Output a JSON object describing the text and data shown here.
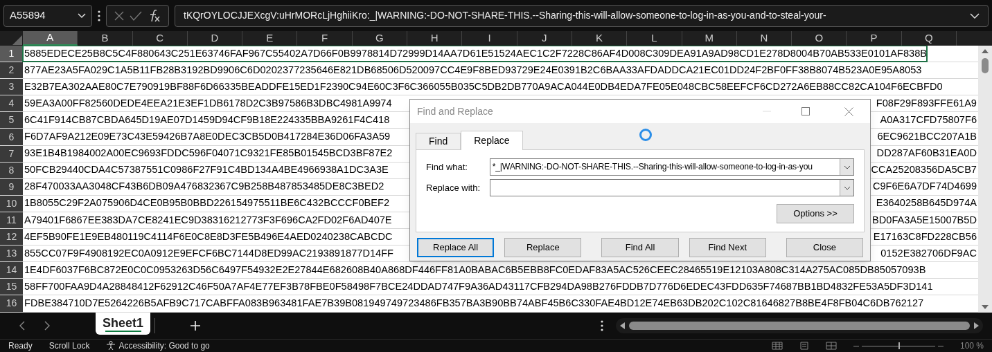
{
  "name_box": {
    "value": "A55894"
  },
  "formula_bar": {
    "value": "tKQrOYLOCJJEXcgV:uHrMORcLjHghiiKro:_|WARNING:-DO-NOT-SHARE-THIS.--Sharing-this-will-allow-someone-to-log-in-as-you-and-to-steal-your-"
  },
  "columns": [
    {
      "label": "A",
      "selected": true
    },
    {
      "label": "B",
      "selected": false
    },
    {
      "label": "C",
      "selected": false
    },
    {
      "label": "D",
      "selected": false
    },
    {
      "label": "E",
      "selected": false
    },
    {
      "label": "F",
      "selected": false
    },
    {
      "label": "G",
      "selected": false
    },
    {
      "label": "H",
      "selected": false
    },
    {
      "label": "I",
      "selected": false
    },
    {
      "label": "J",
      "selected": false
    },
    {
      "label": "K",
      "selected": false
    },
    {
      "label": "L",
      "selected": false
    },
    {
      "label": "M",
      "selected": false
    },
    {
      "label": "N",
      "selected": false
    },
    {
      "label": "O",
      "selected": false
    },
    {
      "label": "P",
      "selected": false
    },
    {
      "label": "Q",
      "selected": false
    }
  ],
  "rows": [
    {
      "number": "1",
      "selected": true,
      "text": "5885EDECE25B8C5C4F880643C251E63746FAF967C55402A7D66F0B9978814D72999D14AA7D61E51524AEC1C2F7228C86AF4D008C309DEA91A9AD98CD1E278D8004B70AB533E0101AF838B"
    },
    {
      "number": "2",
      "selected": false,
      "text": "877AE23A5FA029C1A5B11FB28B3192BD9906C6D0202377235646E821DB68506D520097CC4E9F8BED93729E24E0391B2C6BAA33AFDADDCA21EC01DD24F2BF0FF38B8074B523A0E95A8053"
    },
    {
      "number": "3",
      "selected": false,
      "text": "E32B7EA302AAE80C7E790919BF88F6D66335BEADDFE15ED1F2390C94E60C3F6C366055B035C5DB2DB770A9ACA044E0DB4EDA7FE05E048CBC58EEFCF6CD272A6EB88CC82CA104F6ECBFD0"
    },
    {
      "number": "4",
      "selected": false,
      "text": "59EA3A00FF82560DEDE4EEA21E3EF1DB6178D2C3B97586B3DBC4981A9974",
      "text_right": "F08F29F893FFE61A9"
    },
    {
      "number": "5",
      "selected": false,
      "text": "6C41F914CB87CBDA645D19AE07D1459D94CF9B18E224335BBA9261F4C418",
      "text_right": "A0A317CFD75807F6"
    },
    {
      "number": "6",
      "selected": false,
      "text": "F6D7AF9A212E09E73C43E59426B7A8E0DEC3CB5D0B417284E36D06FA3A59",
      "text_right": "6EC9621BCC207A1B"
    },
    {
      "number": "7",
      "selected": false,
      "text": "93E1B4B1984002A00EC9693FDDC596F04071C9321FE85B01545BCD3BF87E2",
      "text_right": "DD287AF60B31EA0D"
    },
    {
      "number": "8",
      "selected": false,
      "text": "50FCB29440CDA4C57387551C0986F27F91C4BD134A4BE4966938A1DC3A3E",
      "text_right": "CCA25208356DA5CB7"
    },
    {
      "number": "9",
      "selected": false,
      "text": "28F470033AA3048CF43B6DB09A476832367C9B258B487853485DE8C3BED2",
      "text_right": "C9F6E6A7DF74D4699"
    },
    {
      "number": "10",
      "selected": false,
      "text": "1B8055C29F2A075906D4CE0B95B0BBD226154975511BE6C432BCCCF0BEF2",
      "text_right": "E3640258B645D974A"
    },
    {
      "number": "11",
      "selected": false,
      "text": "A79401F6867EE383DA7CE8241EC9D38316212773F3F696CA2FD02F6AD407E",
      "text_right": "BD0FA3A5E15007B5D"
    },
    {
      "number": "12",
      "selected": false,
      "text": "4EF5B90FE1E9EB480119C4114F6E0C8E8D3FE5B496E4AED0240238CABCDC",
      "text_right": "E17163C8FD228CB56"
    },
    {
      "number": "13",
      "selected": false,
      "text": "855CC07F9F4908192EC0A0912E9EFCF6BC7144D8ED99AC2193891877D14FF",
      "text_right": "0152E382706DF9AC"
    },
    {
      "number": "14",
      "selected": false,
      "text": "1E4DF6037F6BC872E0C0C0953263D56C6497F54932E2E27844E682608B40A868DF446FF81A0BABAC6B5EBB8FC0EDAF83A5AC526CEEC28465519E12103A808C314A275AC085DB85057093B"
    },
    {
      "number": "15",
      "selected": false,
      "text": "58FF700FAA9D4A28848412F62912C46F50A7AF4E77EF3B78FBE0F58498F7BCE24DDAD747F9A36AD43117CFB294DA98B276FDDB7D776D6EDEC43FDD635F74687BB1BD4832FE53A5DF3D141"
    },
    {
      "number": "16",
      "selected": false,
      "text": "FDBE384710D7E5264226B5AFB9C717CABFFA083B963481FAE7B39B081949749723486FB357BA3B90BB74ABF45B6C330FAE4BD12E74EB63DB202C102C81646827B8BE4F8FB04C6DB762127"
    }
  ],
  "sheet_tabs": [
    {
      "label": "Sheet1",
      "selected": true
    }
  ],
  "status_bar": {
    "items": [
      "Ready",
      "Scroll Lock",
      "Accessibility: Good to go"
    ],
    "zoom": "100 %",
    "zoom_slider": {
      "level": 0.5
    }
  },
  "dialog": {
    "title": "Find and Replace",
    "tabs": [
      {
        "label": "Find",
        "selected": false
      },
      {
        "label": "Replace",
        "selected": true
      }
    ],
    "fields": [
      {
        "label": "Find what:",
        "value": "*_|WARNING:-DO-NOT-SHARE-THIS.--Sharing-this-will-allow-someone-to-log-in-as-you"
      },
      {
        "label": "Replace with:"
      }
    ],
    "options_button": "Options >>",
    "buttons": [
      {
        "label": "Replace All",
        "default": true
      },
      {
        "label": "Replace",
        "default": false
      },
      {
        "label": "Find All",
        "default": false
      },
      {
        "label": "Find Next",
        "default": false
      },
      {
        "label": "Close",
        "default": false
      }
    ]
  }
}
